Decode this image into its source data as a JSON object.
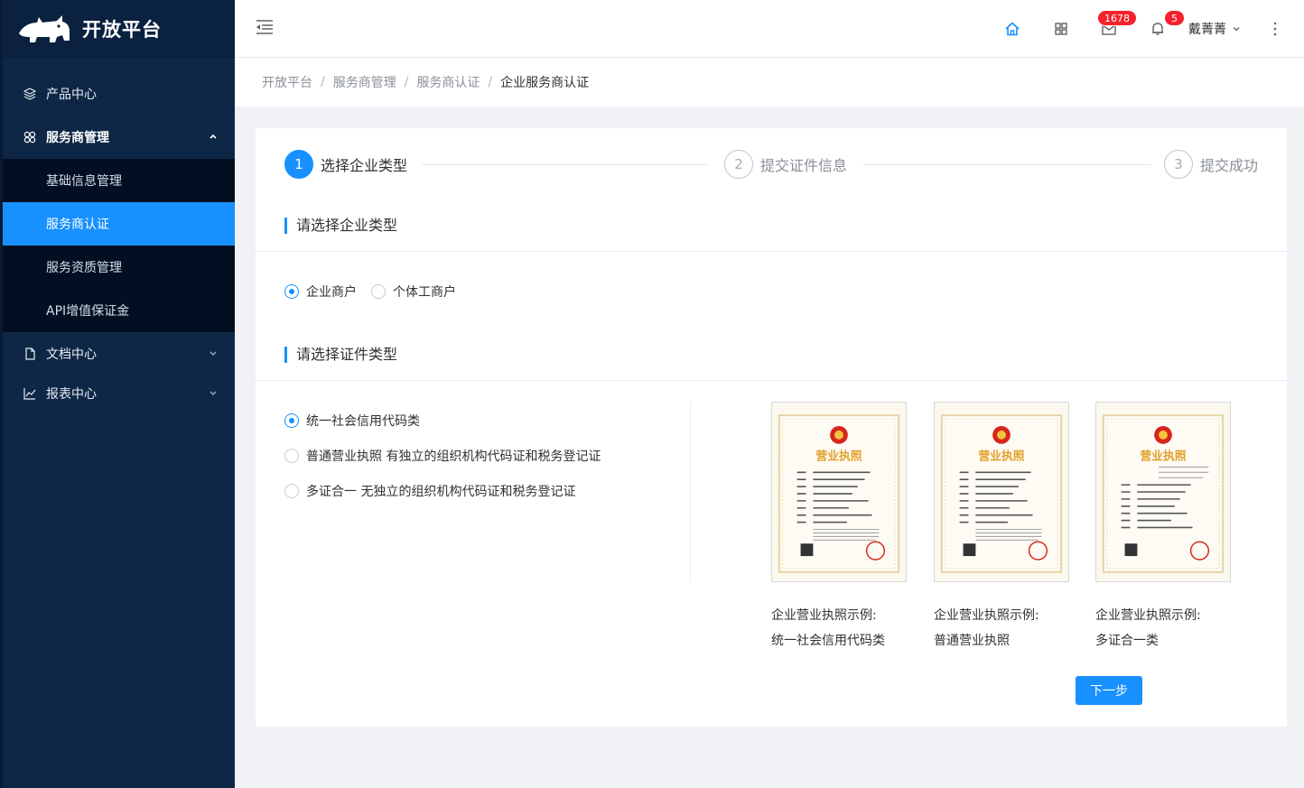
{
  "app": {
    "title": "开放平台"
  },
  "sidebar": {
    "items": [
      {
        "label": "产品中心"
      },
      {
        "label": "服务商管理",
        "open": true,
        "children": [
          {
            "label": "基础信息管理"
          },
          {
            "label": "服务商认证",
            "active": true
          },
          {
            "label": "服务资质管理"
          },
          {
            "label": "API增值保证金"
          }
        ]
      },
      {
        "label": "文档中心"
      },
      {
        "label": "报表中心"
      }
    ]
  },
  "header": {
    "mail_badge": "1678",
    "bell_badge": "5",
    "username": "戴菁菁"
  },
  "breadcrumb": [
    "开放平台",
    "服务商管理",
    "服务商认证",
    "企业服务商认证"
  ],
  "steps": [
    {
      "num": "1",
      "label": "选择企业类型",
      "active": true
    },
    {
      "num": "2",
      "label": "提交证件信息"
    },
    {
      "num": "3",
      "label": "提交成功"
    }
  ],
  "section_enterprise": {
    "title": "请选择企业类型",
    "options": [
      {
        "label": "企业商户",
        "checked": true
      },
      {
        "label": "个体工商户",
        "checked": false
      }
    ]
  },
  "section_cert": {
    "title": "请选择证件类型",
    "options": [
      {
        "label": "统一社会信用代码类",
        "checked": true
      },
      {
        "label": "普通营业执照 有独立的组织机构代码证和税务登记证",
        "checked": false
      },
      {
        "label": "多证合一 无独立的组织机构代码证和税务登记证",
        "checked": false
      }
    ]
  },
  "licenses": [
    {
      "title": "营业执照",
      "caption1": "企业营业执照示例:",
      "caption2": "统一社会信用代码类"
    },
    {
      "title": "营业执照",
      "caption1": "企业营业执照示例:",
      "caption2": "普通营业执照"
    },
    {
      "title": "营业执照",
      "caption1": "企业营业执照示例:",
      "caption2": "多证合一类"
    }
  ],
  "next_button": "下一步",
  "colors": {
    "primary": "#1890ff",
    "sidebar": "#0f2746",
    "submenu": "#020f22",
    "badge": "#f5222d"
  }
}
